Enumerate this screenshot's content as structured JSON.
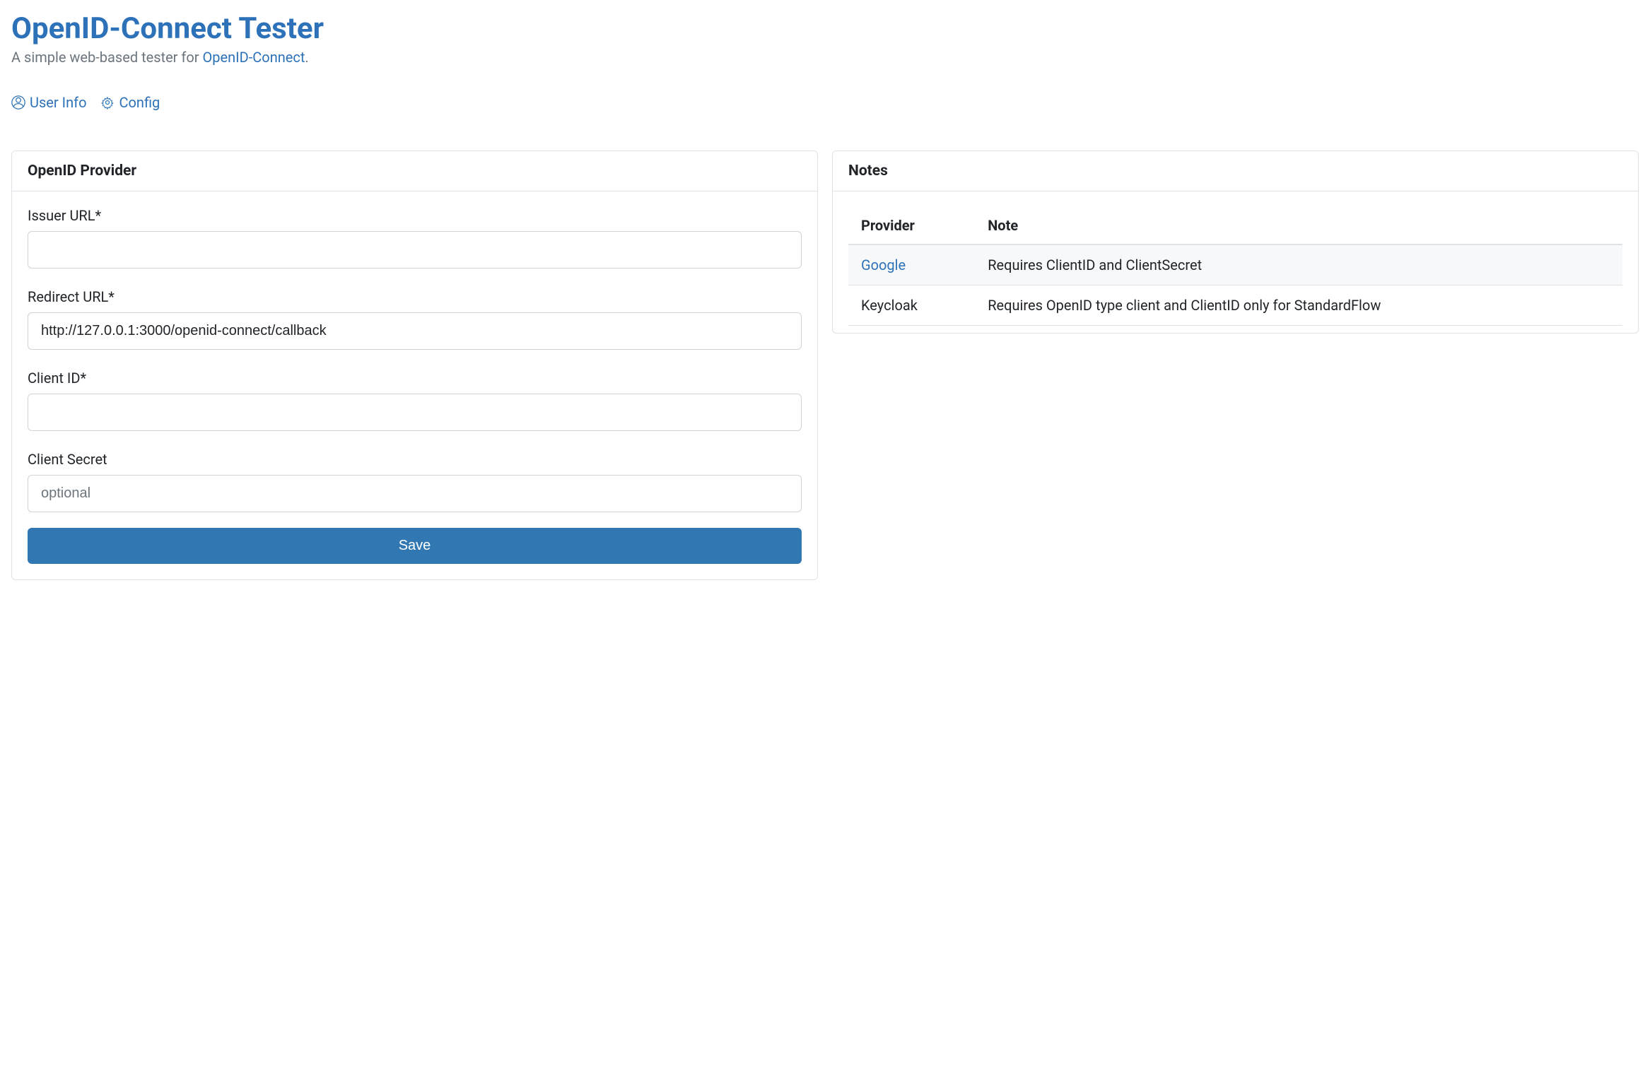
{
  "header": {
    "title": "OpenID-Connect Tester",
    "subtitle_prefix": "A simple web-based tester for ",
    "subtitle_link": "OpenID-Connect",
    "subtitle_suffix": "."
  },
  "nav": {
    "user_info": "User Info",
    "config": "Config"
  },
  "provider_card": {
    "title": "OpenID Provider",
    "issuer_label": "Issuer URL*",
    "issuer_value": "",
    "redirect_label": "Redirect URL*",
    "redirect_value": "http://127.0.0.1:3000/openid-connect/callback",
    "client_id_label": "Client ID*",
    "client_id_value": "",
    "client_secret_label": "Client Secret",
    "client_secret_placeholder": "optional",
    "client_secret_value": "",
    "save_label": "Save"
  },
  "notes_card": {
    "title": "Notes",
    "columns": {
      "provider": "Provider",
      "note": "Note"
    },
    "rows": [
      {
        "provider": "Google",
        "is_link": true,
        "note": "Requires ClientID and ClientSecret"
      },
      {
        "provider": "Keycloak",
        "is_link": false,
        "note": "Requires OpenID type client and ClientID only for StandardFlow"
      }
    ]
  }
}
